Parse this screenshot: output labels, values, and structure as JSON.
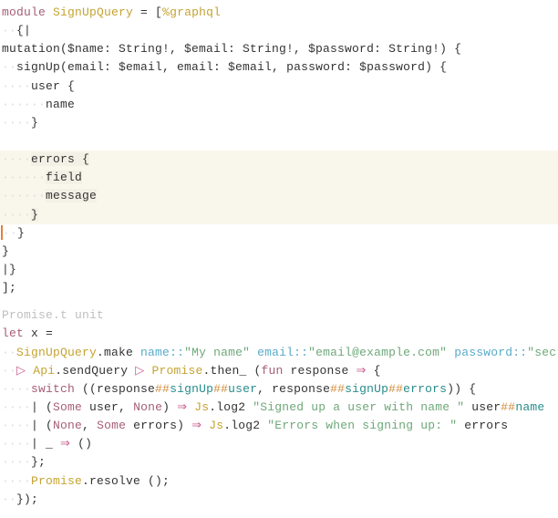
{
  "code": {
    "l1_module": "module",
    "l1_qname": "SignUpQuery",
    "l1_rest": " = [",
    "l1_marker": "%graphql",
    "l2": "  {|",
    "l3": "mutation($name: String!, $email: String!, $password: String!) {",
    "l4": "  signUp(email: $email, email: $email, password: $password) {",
    "l5": "    user {",
    "l6": "      name",
    "l7": "    }",
    "l8_blank": "",
    "l9": "    errors {",
    "l10": "      field",
    "l11": "      message",
    "l12": "    }",
    "l13": "  }",
    "l14": "}",
    "l15": "|}",
    "l16": "];",
    "hint": "Promise.t unit",
    "l17_let": "let",
    "l17_x": " x =",
    "l18_q": "SignUpQuery",
    "l18_make": ".make ",
    "l18_name": "name",
    "l18_sep": "::",
    "l18_name_v": "\"My name\"",
    "l18_email": "email",
    "l18_email_v": "\"email@example.com\"",
    "l18_pw": "password",
    "l18_pw_v": "\"secret\"",
    "l18_end": " ()",
    "pipe": "▷",
    "arrow": "⇒",
    "l19_api": "Api",
    "l19_send": ".sendQuery ",
    "l19_prom": "Promise",
    "l19_then": ".then_ (",
    "l19_fun": "fun",
    "l19_resp": " response ",
    "l19_end": " {",
    "l20_switch": "switch",
    "l20_body": " ((response",
    "hh": "##",
    "l20_signUp": "signUp",
    "l20_user": "user",
    "l20_mid": ", response",
    "l20_errors": "errors",
    "l20_end": ")) {",
    "l21_bar": "| (",
    "some": "Some",
    "none": "None",
    "l21_uc": " user, ",
    "l21_close": ") ",
    "l21_js": "Js",
    "l21_log": ".log2 ",
    "l21_str": "\"Signed up a user with name \"",
    "l21_tail": " user",
    "l21_name": "name",
    "l22_mid": ", ",
    "l22_err": " errors",
    "l22_str": "\"Errors when signing up: \"",
    "l22_tail": " errors",
    "l23": "| _ ",
    "l23_end": " ()",
    "l24": "};",
    "l25_prom": "Promise",
    "l25_res": ".resolve ();",
    "l26": "});"
  }
}
